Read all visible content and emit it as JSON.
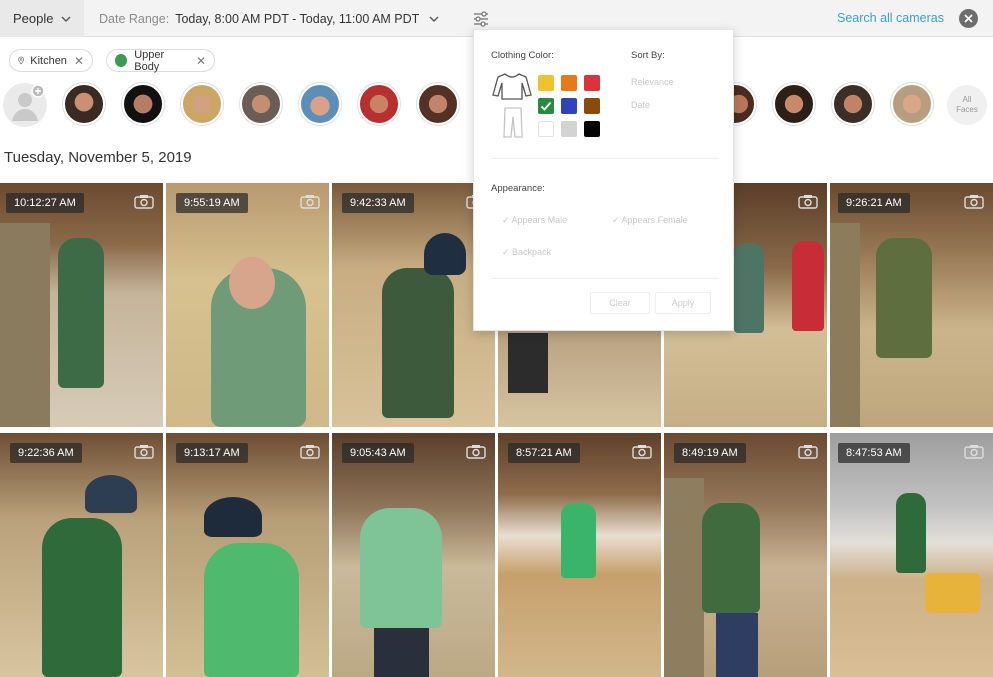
{
  "topbar": {
    "people_label": "People",
    "date_range_label": "Date Range:",
    "date_range_value": "Today, 8:00 AM PDT - Today, 11:00 AM PDT",
    "search_all_cameras": "Search all cameras"
  },
  "chips": [
    {
      "label": "Kitchen"
    },
    {
      "label": "Upper Body"
    }
  ],
  "faces": {
    "all_faces_label_1": "All",
    "all_faces_label_2": "Faces"
  },
  "date_heading": "Tuesday, November 5, 2019",
  "tiles": [
    {
      "time": "10:12:27 AM"
    },
    {
      "time": "9:55:19 AM"
    },
    {
      "time": "9:42:33 AM"
    },
    {
      "time": "AM"
    },
    {
      "time": "9:26:21 AM"
    },
    {
      "time": "9:22:36 AM"
    },
    {
      "time": "9:13:17 AM"
    },
    {
      "time": "9:05:43 AM"
    },
    {
      "time": "8:57:21 AM"
    },
    {
      "time": "8:49:19 AM"
    },
    {
      "time": "8:47:53 AM"
    }
  ],
  "filter_popup": {
    "clothing_color_label": "Clothing Color:",
    "sort_by_label": "Sort By:",
    "sort_options": [
      "Relevance",
      "Date"
    ],
    "appearance_label": "Appearance:",
    "appearance_options": [
      "Appears Male",
      "Appears Female",
      "Backpack"
    ],
    "colors": [
      "#f0c22b",
      "#e57a1b",
      "#d9333f",
      "#2a8a3f",
      "#2f44b8",
      "#8b4a06",
      "#ffffff",
      "#d3d3d3",
      "#050505"
    ],
    "button_clear": "Clear",
    "button_apply": "Apply"
  }
}
